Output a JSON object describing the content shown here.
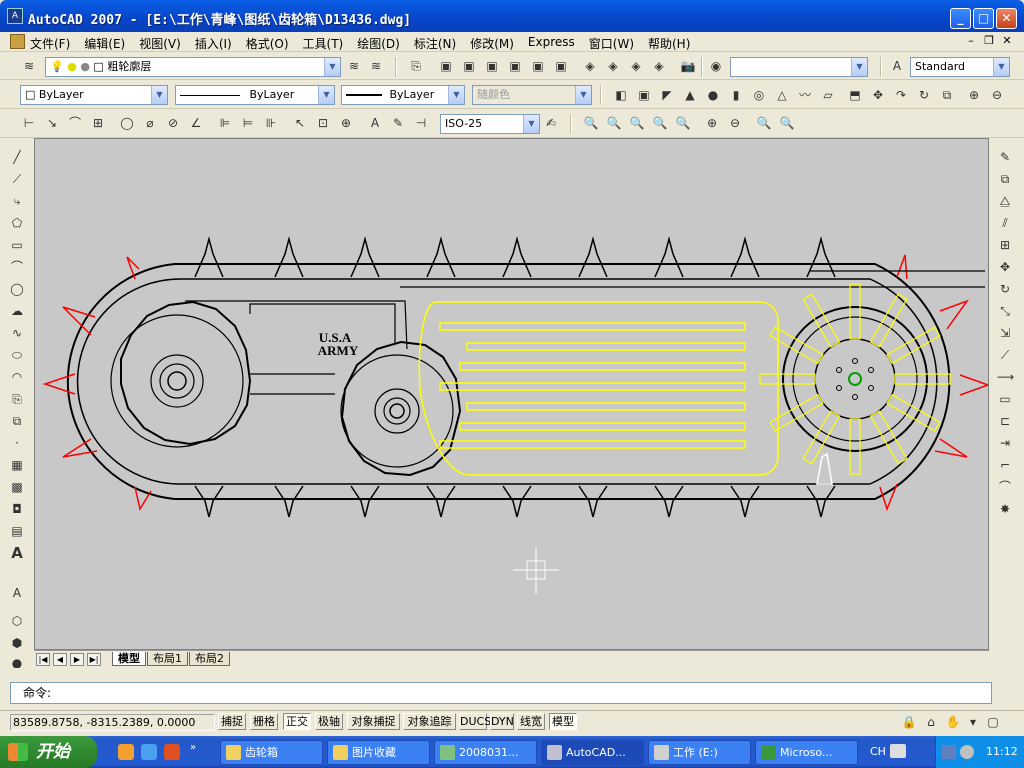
{
  "window": {
    "title": "AutoCAD 2007 - [E:\\工作\\青峰\\图纸\\齿轮箱\\D13436.dwg]",
    "minimize": "_",
    "maximize": "□",
    "close": "✕"
  },
  "menu": {
    "items": [
      "文件(F)",
      "编辑(E)",
      "视图(V)",
      "插入(I)",
      "格式(O)",
      "工具(T)",
      "绘图(D)",
      "标注(N)",
      "修改(M)",
      "Express",
      "窗口(W)",
      "帮助(H)"
    ],
    "mdi": [
      "–",
      "❐",
      "✕"
    ]
  },
  "layers": {
    "current_layer": "粗轮廓层",
    "text_style": "Standard"
  },
  "properties": {
    "color": "ByLayer",
    "linetype": "ByLayer",
    "lineweight": "ByLayer",
    "plot_style": "随颜色"
  },
  "dimension": {
    "dim_style": "ISO-25"
  },
  "drawing": {
    "label_line1": "U.S.A",
    "label_line2": "ARMY",
    "line_color": "#000000",
    "red_color": "#ff0000",
    "yellow_color": "#ffff00",
    "background": "#c8c8c8"
  },
  "layout_tabs": [
    "模型",
    "布局1",
    "布局2"
  ],
  "command": {
    "prompt": "命令:"
  },
  "status": {
    "coordinates": "83589.8758, -8315.2389, 0.0000",
    "buttons": [
      "捕捉",
      "栅格",
      "正交",
      "极轴",
      "对象捕捉",
      "对象追踪",
      "DUCS",
      "DYN",
      "线宽",
      "模型"
    ],
    "active": [
      "正交",
      "模型"
    ]
  },
  "taskbar": {
    "start": "开始",
    "tasks": [
      "齿轮箱",
      "图片收藏",
      "2008031...",
      "AutoCAD...",
      "工作 (E:)",
      "Microso..."
    ],
    "active_task": "AutoCAD...",
    "language": "CH",
    "time": "11:12"
  }
}
